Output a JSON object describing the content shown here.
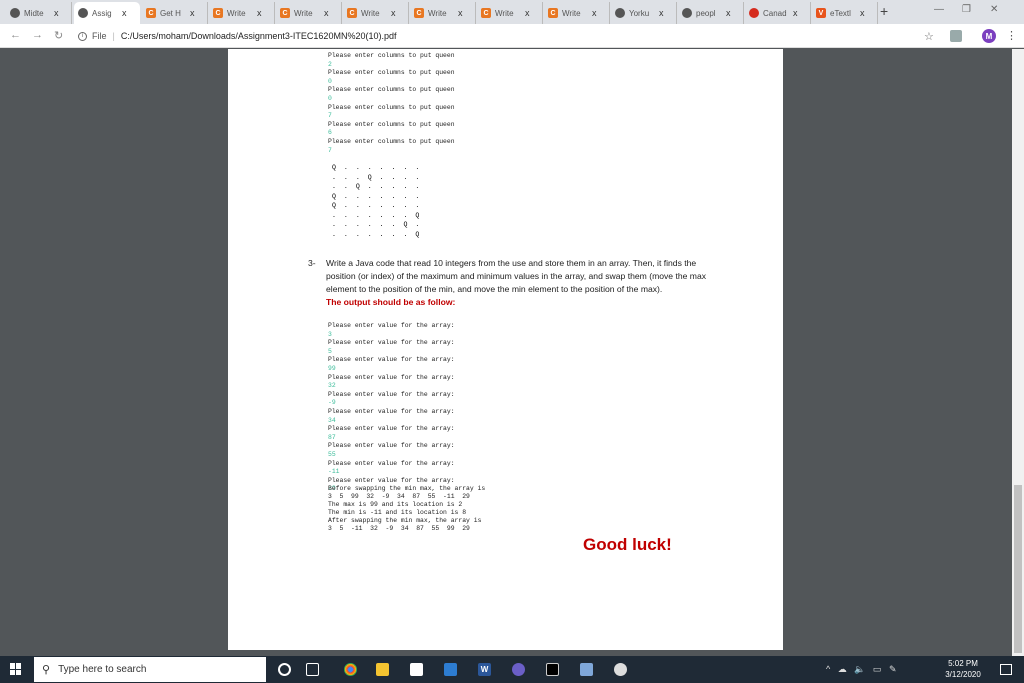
{
  "tabs": [
    {
      "label": "Midte",
      "icon": "globe",
      "color": "#555"
    },
    {
      "label": "Assig",
      "icon": "globe",
      "color": "#555",
      "active": true
    },
    {
      "label": "Get H",
      "icon": "chegg",
      "color": "#e87722"
    },
    {
      "label": "Write",
      "icon": "chegg",
      "color": "#e87722"
    },
    {
      "label": "Write",
      "icon": "chegg",
      "color": "#e87722"
    },
    {
      "label": "Write",
      "icon": "chegg",
      "color": "#e87722"
    },
    {
      "label": "Write",
      "icon": "chegg",
      "color": "#e87722"
    },
    {
      "label": "Write",
      "icon": "chegg",
      "color": "#e87722"
    },
    {
      "label": "Write",
      "icon": "chegg",
      "color": "#e87722"
    },
    {
      "label": "Yorku",
      "icon": "globe",
      "color": "#555"
    },
    {
      "label": "peopl",
      "icon": "globe",
      "color": "#555"
    },
    {
      "label": "Canad",
      "icon": "flag",
      "color": "#d52b1e"
    },
    {
      "label": "eTextl",
      "icon": "v",
      "color": "#e8541c"
    }
  ],
  "tab_close": "x",
  "new_tab": "+",
  "address": {
    "scheme": "File",
    "url": "C:/Users/moham/Downloads/Assignment3-ITEC1620MN%20(10).pdf",
    "avatar": "M"
  },
  "queen_prompts": [
    {
      "prompt": "Please enter columns to put queen",
      "input": "2"
    },
    {
      "prompt": "Please enter columns to put queen",
      "input": "0"
    },
    {
      "prompt": "Please enter columns to put queen",
      "input": "0"
    },
    {
      "prompt": "Please enter columns to put queen",
      "input": "7"
    },
    {
      "prompt": "Please enter columns to put queen",
      "input": "6"
    },
    {
      "prompt": "Please enter columns to put queen",
      "input": "7"
    }
  ],
  "board_rows": [
    "Q . . . . . . .",
    ". . . Q . . . .",
    ". . Q . . . . .",
    "Q . . . . . . .",
    "Q . . . . . . .",
    ". . . . . . . Q",
    ". . . . . . Q .",
    ". . . . . . . Q"
  ],
  "question3": {
    "number": "3-",
    "text": "Write a Java code that read 10 integers from the use and store them in an array. Then, it finds the position (or index) of the maximum and minimum values in the array, and swap them (move the max element to the position of the min, and move the min element to the position of the max).",
    "output_note": "The output should be as follow:"
  },
  "array_prompts": [
    {
      "prompt": "Please enter value for the array:",
      "input": "3"
    },
    {
      "prompt": "Please enter value for the array:",
      "input": "5"
    },
    {
      "prompt": "Please enter value for the array:",
      "input": "99"
    },
    {
      "prompt": "Please enter value for the array:",
      "input": "32"
    },
    {
      "prompt": "Please enter value for the array:",
      "input": "-9"
    },
    {
      "prompt": "Please enter value for the array:",
      "input": "34"
    },
    {
      "prompt": "Please enter value for the array:",
      "input": "87"
    },
    {
      "prompt": "Please enter value for the array:",
      "input": "55"
    },
    {
      "prompt": "Please enter value for the array:",
      "input": "-11"
    },
    {
      "prompt": "Please enter value for the array:",
      "input": "29"
    }
  ],
  "results": [
    "Before swapping the min max, the array is",
    "3  5  99  32  -9  34  87  55  -11  29",
    "The max is 99 and its location is 2",
    "The min is -11 and its location is 8",
    "After swapping the min max, the array is",
    "3  5  -11  32  -9  34  87  55  99  29"
  ],
  "closing": "Good luck!",
  "taskbar": {
    "search_placeholder": "Type here to search",
    "time": "5:02 PM",
    "date": "3/12/2020"
  }
}
